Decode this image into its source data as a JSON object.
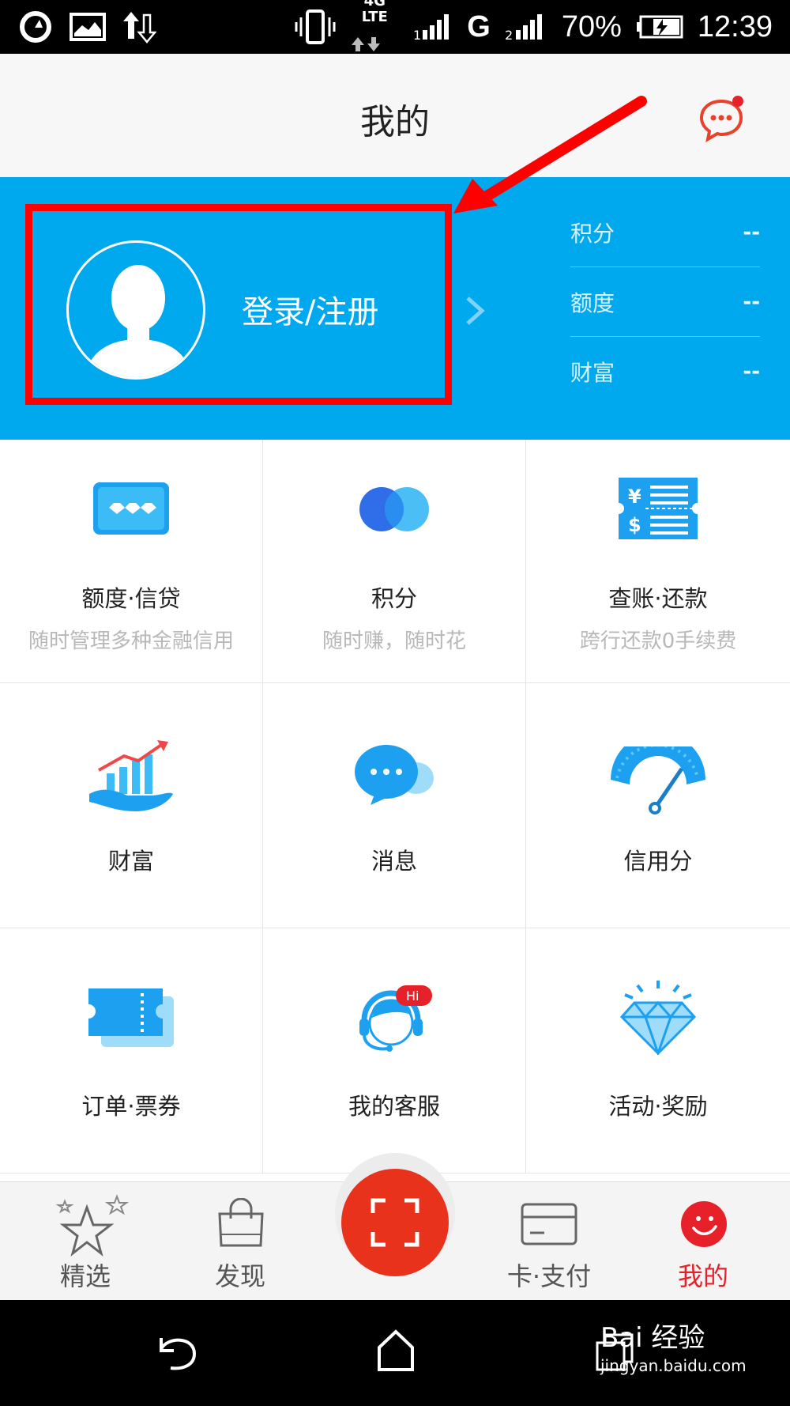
{
  "status_bar": {
    "network": "4G LTE",
    "carrier_g": "G",
    "battery": "70%",
    "time": "12:39"
  },
  "header": {
    "title": "我的",
    "message_icon": "chat-bubble-icon"
  },
  "profile": {
    "login_label": "登录/注册",
    "stats": [
      {
        "label": "积分",
        "value": "--"
      },
      {
        "label": "额度",
        "value": "--"
      },
      {
        "label": "财富",
        "value": "--"
      }
    ]
  },
  "grid": {
    "items": [
      {
        "name": "额度·信贷",
        "desc": "随时管理多种金融信用",
        "icon": "credit-card-icon"
      },
      {
        "name": "积分",
        "desc": "随时赚，随时花",
        "icon": "points-circles-icon"
      },
      {
        "name": "查账·还款",
        "desc": "跨行还款0手续费",
        "icon": "bill-icon"
      },
      {
        "name": "财富",
        "desc": "",
        "icon": "wealth-chart-icon"
      },
      {
        "name": "消息",
        "desc": "",
        "icon": "message-icon"
      },
      {
        "name": "信用分",
        "desc": "",
        "icon": "gauge-icon"
      },
      {
        "name": "订单·票券",
        "desc": "",
        "icon": "ticket-icon"
      },
      {
        "name": "我的客服",
        "desc": "",
        "icon": "customer-service-icon",
        "badge": "Hi"
      },
      {
        "name": "活动·奖励",
        "desc": "",
        "icon": "diamond-icon"
      }
    ]
  },
  "bottom_nav": {
    "items": [
      {
        "label": "精选",
        "icon": "star-icon"
      },
      {
        "label": "发现",
        "icon": "shopping-bag-icon"
      },
      {
        "label": "",
        "icon": "scan-icon"
      },
      {
        "label": "卡·支付",
        "icon": "card-icon"
      },
      {
        "label": "我的",
        "icon": "smiley-icon",
        "active": true
      }
    ]
  },
  "watermark": {
    "brand": "Bai 经验",
    "url": "jingyan.baidu.com"
  },
  "colors": {
    "banner": "#00a8ee",
    "accent_red": "#e62129",
    "highlight": "#ff0000"
  }
}
